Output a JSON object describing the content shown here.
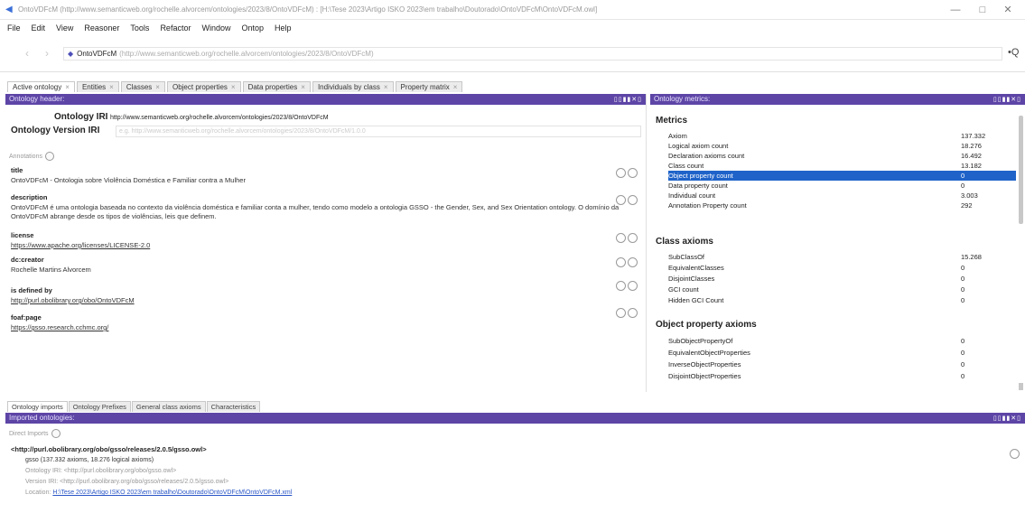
{
  "window": {
    "title": "OntoVDFcM (http://www.semanticweb.org/rochelle.alvorcem/ontologies/2023/8/OntoVDFcM) : [H:\\Tese 2023\\Artigo ISKO 2023\\em trabalho\\Doutorado\\OntoVDFcM\\OntoVDFcM.owl]",
    "minimize": "—",
    "maximize": "□",
    "close": "✕"
  },
  "menu": [
    "File",
    "Edit",
    "View",
    "Reasoner",
    "Tools",
    "Refactor",
    "Window",
    "Ontop",
    "Help"
  ],
  "address": {
    "back": "‹",
    "forward": "›",
    "ontology_name": "OntoVDFcM",
    "ontology_iri": "(http://www.semanticweb.org/rochelle.alvorcem/ontologies/2023/8/OntoVDFcM)",
    "search_icon": "•Q"
  },
  "tabs": [
    {
      "label": "Active ontology",
      "active": true
    },
    {
      "label": "Entities",
      "active": false
    },
    {
      "label": "Classes",
      "active": false
    },
    {
      "label": "Object properties",
      "active": false
    },
    {
      "label": "Data properties",
      "active": false
    },
    {
      "label": "Individuals by class",
      "active": false
    },
    {
      "label": "Property matrix",
      "active": false
    }
  ],
  "tab_close": "×",
  "ontology_header": {
    "view_title": "Ontology header:",
    "ontology_iri_label": "Ontology IRI",
    "ontology_iri_value": "http://www.semanticweb.org/rochelle.alvorcem/ontologies/2023/8/OntoVDFcM",
    "version_iri_label": "Ontology Version IRI",
    "version_iri_value": "e.g. http://www.semanticweb.org/rochelle.alvorcem/ontologies/2023/8/OntoVDFcM/1.0.0",
    "annotations_label": "Annotations",
    "annotations": [
      {
        "property": "title",
        "value": "OntoVDFcM - Ontologia sobre Violência Doméstica e Familiar contra a Mulher",
        "link": false
      },
      {
        "property": "description",
        "value": "OntoVDFcM é uma ontologia baseada no contexto da violência doméstica e familiar conta a mulher, tendo como modelo a ontologia GSSO - the Gender, Sex, and Sex Orientation ontology. O domínio da OntoVDFcM abrange desde os tipos de violências, leis que definem.",
        "link": false
      },
      {
        "property": "license",
        "value": "https://www.apache.org/licenses/LICENSE-2.0",
        "link": true
      },
      {
        "property": "dc:creator",
        "value": "Rochelle Martins Alvorcem",
        "link": false
      },
      {
        "property": "is defined by",
        "value": "http://purl.obolibrary.org/obo/OntoVDFcM",
        "link": true
      },
      {
        "property": "foaf:page",
        "value": "https://gsso.research.cchmc.org/",
        "link": true
      }
    ]
  },
  "ontology_metrics": {
    "view_title": "Ontology metrics:",
    "sections": [
      {
        "title": "Metrics",
        "rows": [
          {
            "label": "Axiom",
            "value": "137.332"
          },
          {
            "label": "Logical axiom count",
            "value": "18.276"
          },
          {
            "label": "Declaration axioms count",
            "value": "16.492"
          },
          {
            "label": "Class count",
            "value": "13.182"
          },
          {
            "label": "Object property count",
            "value": "0"
          },
          {
            "label": "Data property count",
            "value": "0"
          },
          {
            "label": "Individual count",
            "value": "3.003"
          },
          {
            "label": "Annotation Property count",
            "value": "292"
          }
        ]
      },
      {
        "title": "Class axioms",
        "rows": [
          {
            "label": "SubClassOf",
            "value": "15.268"
          },
          {
            "label": "EquivalentClasses",
            "value": "0"
          },
          {
            "label": "DisjointClasses",
            "value": "0"
          },
          {
            "label": "GCI count",
            "value": "0"
          },
          {
            "label": "Hidden GCI Count",
            "value": "0"
          }
        ]
      },
      {
        "title": "Object property axioms",
        "rows": [
          {
            "label": "SubObjectPropertyOf",
            "value": "0"
          },
          {
            "label": "EquivalentObjectProperties",
            "value": "0"
          },
          {
            "label": "InverseObjectProperties",
            "value": "0"
          },
          {
            "label": "DisjointObjectProperties",
            "value": "0"
          }
        ]
      }
    ],
    "selected_row": "Object property count"
  },
  "bottom_tabs": [
    {
      "label": "Ontology imports",
      "active": true
    },
    {
      "label": "Ontology Prefixes",
      "active": false
    },
    {
      "label": "General class axioms",
      "active": false
    },
    {
      "label": "Characteristics",
      "active": false
    }
  ],
  "imports": {
    "view_title": "Imported ontologies:",
    "direct_label": "Direct Imports",
    "import_iri": "<http://purl.obolibrary.org/obo/gsso/releases/2.0.5/gsso.owl>",
    "name_line": "gsso   (137.332 axioms, 18.276 logical axioms)",
    "ontology_iri_line": "Ontology IRI: <http://purl.obolibrary.org/obo/gsso.owl>",
    "version_iri_line": "Version IRI: <http://purl.obolibrary.org/obo/gsso/releases/2.0.5/gsso.owl>",
    "location_label": "Location:",
    "location_value": "H:\\Tese 2023\\Artigo ISKO 2023\\em trabalho\\Doutorado\\OntoVDFcM\\OntoVDFcM.xml"
  },
  "view_controls": "▯▯▮▮✕▯"
}
